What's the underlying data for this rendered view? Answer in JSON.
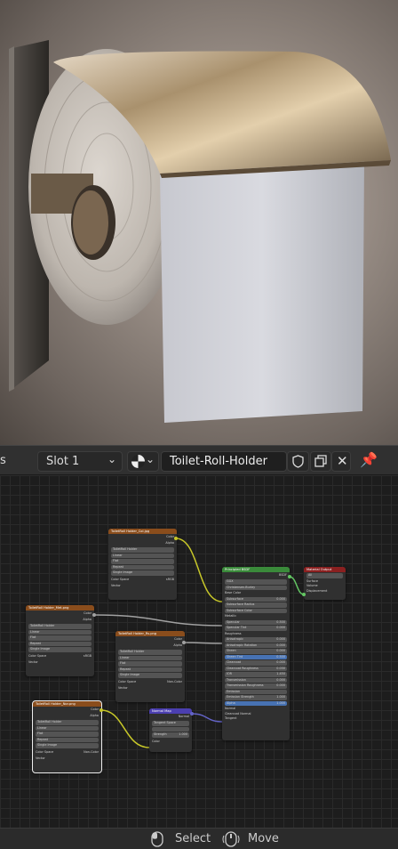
{
  "header": {
    "left_label": "s",
    "slot": "Slot 1",
    "material_name": "Toilet-Roll-Holder"
  },
  "status": {
    "select": "Select",
    "move": "Move"
  },
  "nodes": {
    "tex1": {
      "title": "ToiletRoll Holder_Col.jpg",
      "out1": "Color",
      "out2": "Alpha",
      "image": "ToiletRoll Holder",
      "f1": "Linear",
      "f2": "Flat",
      "f3": "Repeat",
      "f4": "Single Image",
      "cs": "Color Space",
      "csv": "sRGB",
      "vec": "Vector"
    },
    "tex2": {
      "title": "ToiletRoll Holder_Met.png",
      "out1": "Color",
      "out2": "Alpha",
      "image": "ToiletRoll Holder",
      "f1": "Linear",
      "f2": "Flat",
      "f3": "Repeat",
      "f4": "Single Image",
      "cs": "Color Space",
      "csv": "sRGB",
      "vec": "Vector"
    },
    "tex3": {
      "title": "ToiletRoll Holder_Rs.png",
      "out1": "Color",
      "out2": "Alpha",
      "image": "ToiletRoll Holder",
      "f1": "Linear",
      "f2": "Flat",
      "f3": "Repeat",
      "f4": "Single Image",
      "cs": "Color Space",
      "csv": "Non-Color",
      "vec": "Vector"
    },
    "tex4": {
      "title": "ToiletRoll Holder_Nor.png",
      "out1": "Color",
      "out2": "Alpha",
      "image": "ToiletRoll Holder",
      "f1": "Linear",
      "f2": "Flat",
      "f3": "Repeat",
      "f4": "Single Image",
      "cs": "Color Space",
      "csv": "Non-Color",
      "vec": "Vector"
    },
    "normal": {
      "title": "Normal Map",
      "out": "Normal",
      "space": "Tangent Space",
      "strength": "Strength",
      "strength_val": "1.000",
      "color": "Color"
    },
    "output": {
      "title": "Material Output",
      "target": "All",
      "surface": "Surface",
      "volume": "Volume",
      "disp": "Displacement"
    },
    "bsdf": {
      "title": "Principled BSDF",
      "out": "BSDF",
      "dist": "GGX",
      "sss": "Christensen-Burley",
      "rows": [
        {
          "l": "Base Color",
          "v": "",
          "t": "sock"
        },
        {
          "l": "Subsurface",
          "v": "0.000",
          "t": "fld"
        },
        {
          "l": "Subsurface Radius",
          "v": "",
          "t": "fld"
        },
        {
          "l": "Subsurface Color",
          "v": "",
          "t": "fld"
        },
        {
          "l": "Metallic",
          "v": "",
          "t": "sock"
        },
        {
          "l": "Specular",
          "v": "0.500",
          "t": "fld"
        },
        {
          "l": "Specular Tint",
          "v": "0.000",
          "t": "fld"
        },
        {
          "l": "Roughness",
          "v": "",
          "t": "sock"
        },
        {
          "l": "Anisotropic",
          "v": "0.000",
          "t": "fld"
        },
        {
          "l": "Anisotropic Rotation",
          "v": "0.000",
          "t": "fld"
        },
        {
          "l": "Sheen",
          "v": "0.000",
          "t": "fld"
        },
        {
          "l": "Sheen Tint",
          "v": "0.500",
          "t": "blue"
        },
        {
          "l": "Clearcoat",
          "v": "0.000",
          "t": "fld"
        },
        {
          "l": "Clearcoat Roughness",
          "v": "0.030",
          "t": "fld"
        },
        {
          "l": "IOR",
          "v": "1.450",
          "t": "fld"
        },
        {
          "l": "Transmission",
          "v": "0.000",
          "t": "fld"
        },
        {
          "l": "Transmission Roughness",
          "v": "0.000",
          "t": "fld"
        },
        {
          "l": "Emission",
          "v": "",
          "t": "fld"
        },
        {
          "l": "Emission Strength",
          "v": "1.000",
          "t": "fld"
        },
        {
          "l": "Alpha",
          "v": "1.000",
          "t": "blue"
        },
        {
          "l": "Normal",
          "v": "",
          "t": "sock"
        },
        {
          "l": "Clearcoat Normal",
          "v": "",
          "t": "sock"
        },
        {
          "l": "Tangent",
          "v": "",
          "t": "sock"
        }
      ]
    }
  },
  "colors": {
    "texture_header": "#8a4d1c",
    "bsdf_header": "#3a8a3a",
    "output_header": "#8a2020",
    "vector_header": "#4b3fb0",
    "accent": "#4772b3"
  }
}
